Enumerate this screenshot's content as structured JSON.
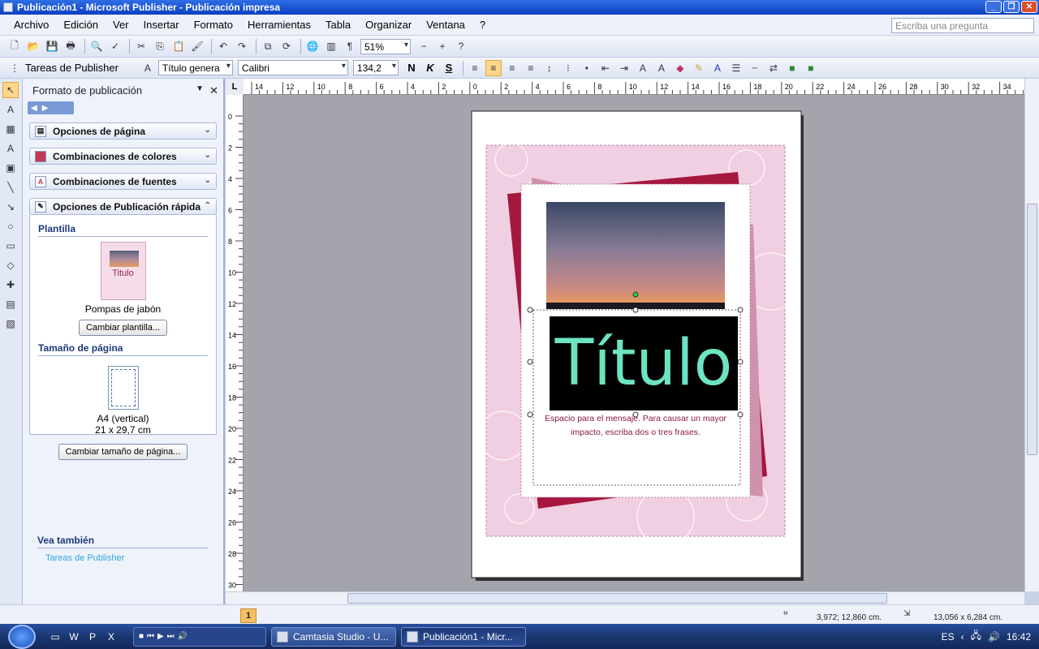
{
  "window": {
    "title": "Publicación1 - Microsoft Publisher  -  Publicación impresa"
  },
  "menu": [
    "Archivo",
    "Edición",
    "Ver",
    "Insertar",
    "Formato",
    "Herramientas",
    "Tabla",
    "Organizar",
    "Ventana",
    "?"
  ],
  "help_placeholder": "Escriba una pregunta",
  "toolbar": {
    "zoom": "51%"
  },
  "format_bar": {
    "tasks": "Tareas de Publisher",
    "style": "Título genera",
    "font": "Calibri",
    "size": "134,2",
    "bold": "N",
    "italic": "K",
    "strike": "S"
  },
  "taskpane": {
    "title": "Formato de publicación",
    "sections": [
      "Opciones de página",
      "Combinaciones de colores",
      "Combinaciones de fuentes",
      "Opciones de Publicación rápida"
    ],
    "template_heading": "Plantilla",
    "template_thumb_title": "Titulo",
    "template_name": "Pompas de jabón",
    "change_template": "Cambiar plantilla...",
    "page_size_heading": "Tamaño de página",
    "page_size_name": "A4 (vertical)",
    "page_size_dims": "21 x 29,7 cm",
    "change_size": "Cambiar tamaño de página...",
    "see_also": "Vea también",
    "see_also_link": "Tareas de Publisher"
  },
  "ruler": {
    "corner": "L",
    "h_labels": [
      "14",
      "12",
      "10",
      "8",
      "6",
      "4",
      "2",
      "0",
      "2",
      "4",
      "6",
      "8",
      "10",
      "12",
      "14",
      "16",
      "18",
      "20",
      "22",
      "24",
      "26",
      "28",
      "30",
      "32",
      "34"
    ],
    "v_labels": [
      "0",
      "2",
      "4",
      "6",
      "8",
      "10",
      "12",
      "14",
      "16",
      "18",
      "20",
      "22",
      "24",
      "26",
      "28",
      "30"
    ]
  },
  "document": {
    "title": "Título",
    "message": "Espacio para el mensaje. Para causar un mayor impacto, escriba dos o tres frases."
  },
  "status": {
    "page": "1",
    "position": "3,972; 12,860 cm.",
    "size": "13,056 x  6,284 cm."
  },
  "taskbar": {
    "items": [
      "Camtasia Studio - U...",
      "Publicación1 - Micr..."
    ],
    "lang": "ES",
    "time": "16:42"
  }
}
